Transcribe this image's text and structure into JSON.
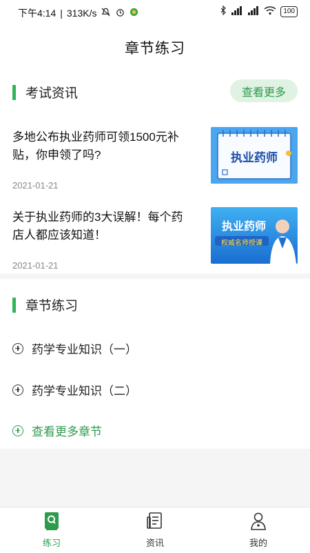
{
  "status_bar": {
    "time": "下午4:14",
    "speed": "313K/s",
    "battery": "100"
  },
  "header": {
    "title": "章节练习"
  },
  "news": {
    "section_title": "考试资讯",
    "more_label": "查看更多",
    "items": [
      {
        "title": "多地公布执业药师可领1500元补贴，你申领了吗?",
        "date": "2021-01-21",
        "thumb_text": "执业药师"
      },
      {
        "title": "关于执业药师的3大误解！每个药店人都应该知道！",
        "date": "2021-01-21",
        "thumb_text": "执业药师",
        "thumb_subtext": "权威名师授课"
      }
    ]
  },
  "chapters": {
    "section_title": "章节练习",
    "items": [
      {
        "label": "药学专业知识（一）"
      },
      {
        "label": "药学专业知识（二）"
      }
    ],
    "more_label": "查看更多章节"
  },
  "tabbar": {
    "tabs": [
      {
        "label": "练习",
        "icon": "practice-book-icon",
        "active": true
      },
      {
        "label": "资讯",
        "icon": "news-icon",
        "active": false
      },
      {
        "label": "我的",
        "icon": "profile-icon",
        "active": false
      }
    ]
  },
  "colors": {
    "accent": "#35b35a",
    "accent_text": "#2e9b4c",
    "accent_bg": "#dff2e3"
  }
}
